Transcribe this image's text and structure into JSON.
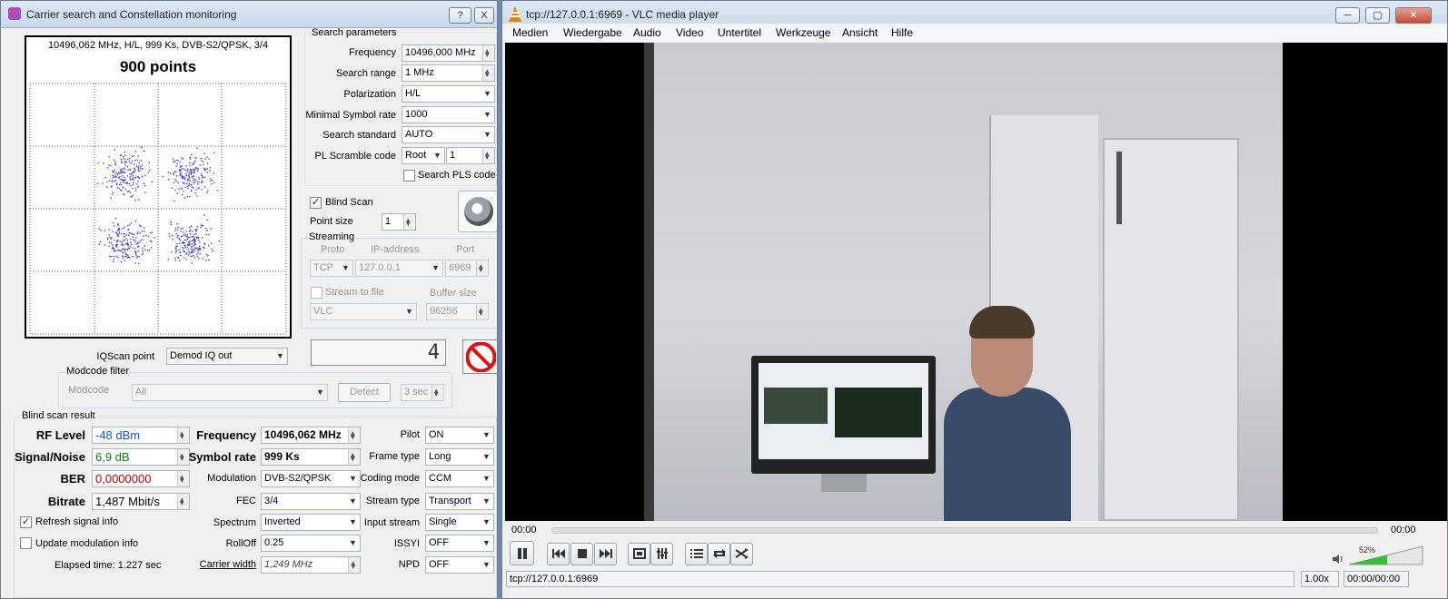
{
  "left_window": {
    "title": "Carrier search and Constellation monitoring",
    "help_btn": "?",
    "close_btn": "X",
    "constellation": {
      "info": "10496,062 MHz, H/L, 999 Ks, DVB-S2/QPSK, 3/4",
      "points_label": "900 points"
    },
    "search_params": {
      "title": "Search parameters",
      "frequency_label": "Frequency",
      "frequency": "10496,000 MHz",
      "range_label": "Search range",
      "range": "1 MHz",
      "polarization_label": "Polarization",
      "polarization": "H/L",
      "min_sr_label": "Minimal Symbol rate",
      "min_sr": "1000",
      "standard_label": "Search standard",
      "standard": "AUTO",
      "pls_label": "PL Scramble code",
      "pls_mode": "Root",
      "pls_value": "1",
      "search_pls_label": "Search PLS code"
    },
    "blind_scan_label": "Blind Scan",
    "point_size_label": "Point size",
    "point_size": "1",
    "streaming": {
      "title": "Streaming",
      "proto_label": "Proto",
      "ip_label": "IP-address",
      "port_label": "Port",
      "proto": "TCP",
      "ip": "127.0.0.1",
      "port": "6969",
      "stream_to_file_label": "Stream to file",
      "buffer_label": "Buffer size",
      "player": "VLC",
      "buffer": "96256"
    },
    "iqscan_label": "IQScan point",
    "iqscan": "Demod IQ out",
    "counter": "4",
    "modcode": {
      "title": "Modcode filter",
      "label": "Modcode",
      "value": "All",
      "detect": "Detect",
      "interval": "3 sec"
    },
    "result": {
      "title": "Blind scan result",
      "rf_label": "RF Level",
      "rf": "-48 dBm",
      "sn_label": "Signal/Noise",
      "sn": "6,9 dB",
      "ber_label": "BER",
      "ber": "0,0000000",
      "bitrate_label": "Bitrate",
      "bitrate": "1,487 Mbit/s",
      "freq_label": "Frequency",
      "freq": "10496,062 MHz",
      "sr_label": "Symbol rate",
      "sr": "999 Ks",
      "mod_label": "Modulation",
      "mod": "DVB-S2/QPSK",
      "fec_label": "FEC",
      "fec": "3/4",
      "spectrum_label": "Spectrum",
      "spectrum": "Inverted",
      "rolloff_label": "RollOff",
      "rolloff": "0.25",
      "cw_label": "Carrier width",
      "cw": "1,249 MHz",
      "pilot_label": "Pilot",
      "pilot": "ON",
      "frame_label": "Frame type",
      "frame": "Long",
      "coding_label": "Coding mode",
      "coding": "CCM",
      "stream_type_label": "Stream type",
      "stream_type": "Transport",
      "input_stream_label": "Input stream",
      "input_stream": "Single",
      "issyi_label": "ISSYI",
      "issyi": "OFF",
      "npd_label": "NPD",
      "npd": "OFF"
    },
    "refresh_label": "Refresh signal info",
    "update_mod_label": "Update modulation info",
    "elapsed": "Elapsed time: 1.227 sec",
    "colors": {
      "rf": "#1a55b0",
      "sn": "#1a7a1a",
      "ber": "#c00000"
    }
  },
  "vlc": {
    "title": "tcp://127.0.0.1:6969 - VLC media player",
    "menu": [
      "Medien",
      "Wiedergabe",
      "Audio",
      "Video",
      "Untertitel",
      "Werkzeuge",
      "Ansicht",
      "Hilfe"
    ],
    "time_elapsed": "00:00",
    "time_total": "00:00",
    "volume": "52%",
    "volume_level": 0.52,
    "playback_progress": 0,
    "status_url": "tcp://127.0.0.1:6969",
    "speed": "1.00x",
    "status_time": "00:00/00:00",
    "icons": [
      "pause-icon",
      "prev-icon",
      "stop-icon",
      "next-icon",
      "fullscreen-icon",
      "extended-settings-icon",
      "playlist-icon",
      "loop-icon",
      "shuffle-icon",
      "speaker-icon"
    ]
  }
}
